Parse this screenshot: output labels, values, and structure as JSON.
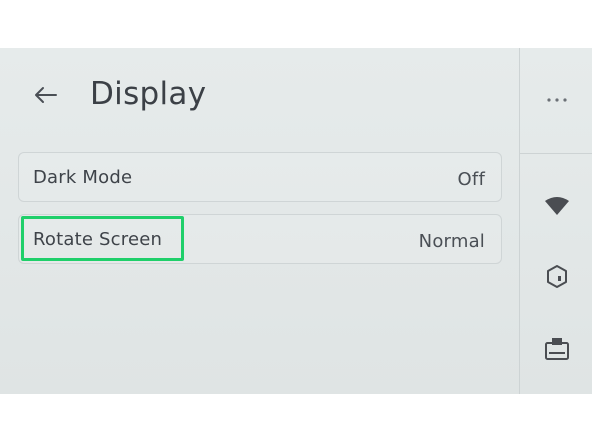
{
  "header": {
    "title": "Display"
  },
  "settings": [
    {
      "label": "Dark Mode",
      "value": "Off"
    },
    {
      "label": "Rotate Screen",
      "value": "Normal"
    }
  ],
  "sidebar": {
    "icons": [
      "more-icon",
      "wifi-icon",
      "cube-icon",
      "card-reader-icon"
    ]
  },
  "colors": {
    "background": "#e4e9e9",
    "text": "#3b4046",
    "highlight": "#1fcf6a",
    "border": "#cfd5d6"
  }
}
